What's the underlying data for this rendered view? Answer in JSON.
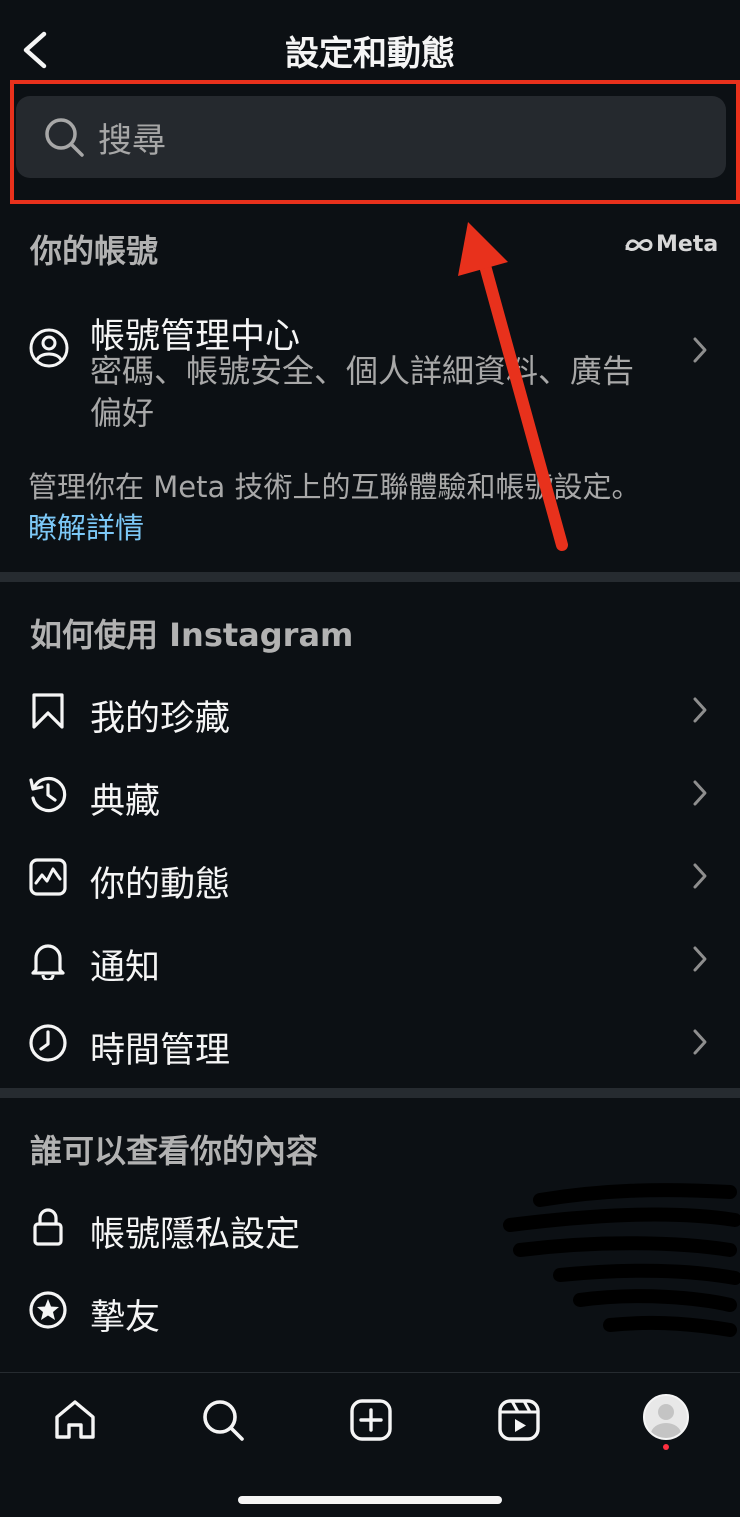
{
  "header": {
    "title": "設定和動態",
    "back_icon": "chevron-left-icon"
  },
  "search": {
    "placeholder": "搜尋",
    "icon": "search-icon"
  },
  "account_section": {
    "title": "你的帳號",
    "meta_brand": "Meta",
    "center_title": "帳號管理中心",
    "center_desc": "密碼、帳號安全、個人詳細資料、廣告偏好",
    "note": "管理你在 Meta 技術上的互聯體驗和帳號設定。",
    "learn_more": "瞭解詳情"
  },
  "how_section": {
    "title": "如何使用 Instagram",
    "items": [
      {
        "label": "我的珍藏",
        "icon": "bookmark-icon"
      },
      {
        "label": "典藏",
        "icon": "archive-history-icon"
      },
      {
        "label": "你的動態",
        "icon": "activity-icon"
      },
      {
        "label": "通知",
        "icon": "bell-icon"
      },
      {
        "label": "時間管理",
        "icon": "clock-icon"
      }
    ]
  },
  "who_section": {
    "title": "誰可以查看你的內容",
    "items": [
      {
        "label": "帳號隱私設定",
        "icon": "lock-icon"
      },
      {
        "label": "摯友",
        "icon": "star-circle-icon"
      }
    ]
  },
  "tabbar": {
    "items": [
      "home-icon",
      "search-icon",
      "create-icon",
      "reels-icon",
      "profile-avatar"
    ]
  },
  "colors": {
    "background": "#0c1014",
    "search_bg": "#25292e",
    "link": "#7cc8f7",
    "highlight": "#e8311c"
  }
}
